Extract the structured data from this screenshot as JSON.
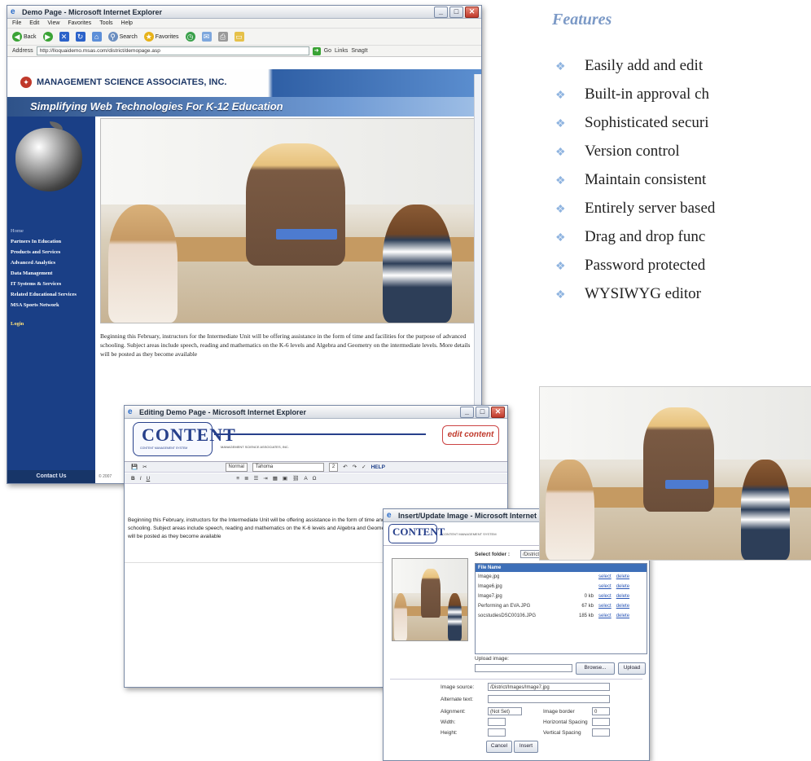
{
  "main_window": {
    "title": "Demo Page - Microsoft Internet Explorer",
    "menu": [
      "File",
      "Edit",
      "View",
      "Favorites",
      "Tools",
      "Help"
    ],
    "toolbar": {
      "back": "Back",
      "search": "Search",
      "favorites": "Favorites"
    },
    "address_label": "Address",
    "address_url": "http://lloquaidemo.msas.com/district/demopage.asp",
    "go_label": "Go",
    "links_label": "Links",
    "snagit_label": "SnagIt",
    "company": "MANAGEMENT SCIENCE ASSOCIATES, INC.",
    "tagline": "Simplifying Web Technologies For K-12 Education",
    "nav": {
      "home": "Home",
      "items": [
        "Partners In Education",
        "Products and Services",
        "Advanced Analytics",
        "Data Management",
        "IT Systems & Services",
        "Related Educational Services",
        "MSA Sports Network"
      ],
      "login": "Login"
    },
    "body_text": "Beginning this February, instructors for the Intermediate Unit will be offering assistance in the form of time and facilities for the purpose of advanced schooling. Subject areas include speech, reading and mathematics on the K-6 levels and Algebra and Geometry on the intermediate levels. More details will be posted as they become available",
    "contact": "Contact Us",
    "copyright": "© 2007"
  },
  "editor_window": {
    "title": "Editing Demo Page - Microsoft Internet Explorer",
    "logo": "CONTENT",
    "logo_sub": "CONTENT MANAGEMENT SYSTEM",
    "msa_small": "MANAGEMENT SCIENCE ASSOCIATES, INC.",
    "badge": "edit content",
    "style_select": "Normal",
    "font_select": "Tahoma",
    "size_select": "2",
    "help": "HELP",
    "body_text": "Beginning this February, instructors for the Intermediate Unit will be offering assistance in the form of time and facilities for the purpose of advanced schooling. Subject areas include speech, reading and mathematics on the K-6 levels and Algebra and Geometry on the intermediate levels. More details will be posted as they become available"
  },
  "image_dialog": {
    "title": "Insert/Update Image - Microsoft Internet Explorer",
    "logo": "CONTENT",
    "logo_sub": "CONTENT MANAGEMENT SYSTEM",
    "select_folder_label": "Select folder :",
    "select_folder_value": "/District/Images",
    "file_header": "File Name",
    "files": [
      {
        "name": "Image.jpg",
        "size": ""
      },
      {
        "name": "Image6.jpg",
        "size": ""
      },
      {
        "name": "Image7.jpg",
        "size": "0 kb"
      },
      {
        "name": "Performing an EVA.JPG",
        "size": "67 kb"
      },
      {
        "name": "socstudiesDSC00106.JPG",
        "size": "185 kb"
      }
    ],
    "select_link": "select",
    "delete_link": "delete",
    "upload_label": "Upload image:",
    "browse": "Browse...",
    "upload": "Upload",
    "image_source_label": "Image source:",
    "image_source_value": "/District/Images/Image7.jpg",
    "alt_text_label": "Alternate text:",
    "alignment_label": "Alignment:",
    "alignment_value": "(Not Set)",
    "border_label": "Image border",
    "border_value": "0",
    "width_label": "Width:",
    "hspace_label": "Horizontal Spacing",
    "height_label": "Height:",
    "vspace_label": "Vertical Spacing",
    "cancel": "Cancel",
    "insert": "Insert"
  },
  "features": {
    "title": "Features",
    "items": [
      "Easily add and edit",
      "Built-in approval ch",
      "Sophisticated securi",
      "Version control",
      "Maintain consistent",
      "Entirely server based",
      "Drag and drop func",
      "Password protected",
      "WYSIWYG editor"
    ]
  },
  "colors": {
    "brand_blue": "#1a3f86",
    "arrow_orange": "#f08a3c",
    "feature_title": "#7b99c6"
  }
}
